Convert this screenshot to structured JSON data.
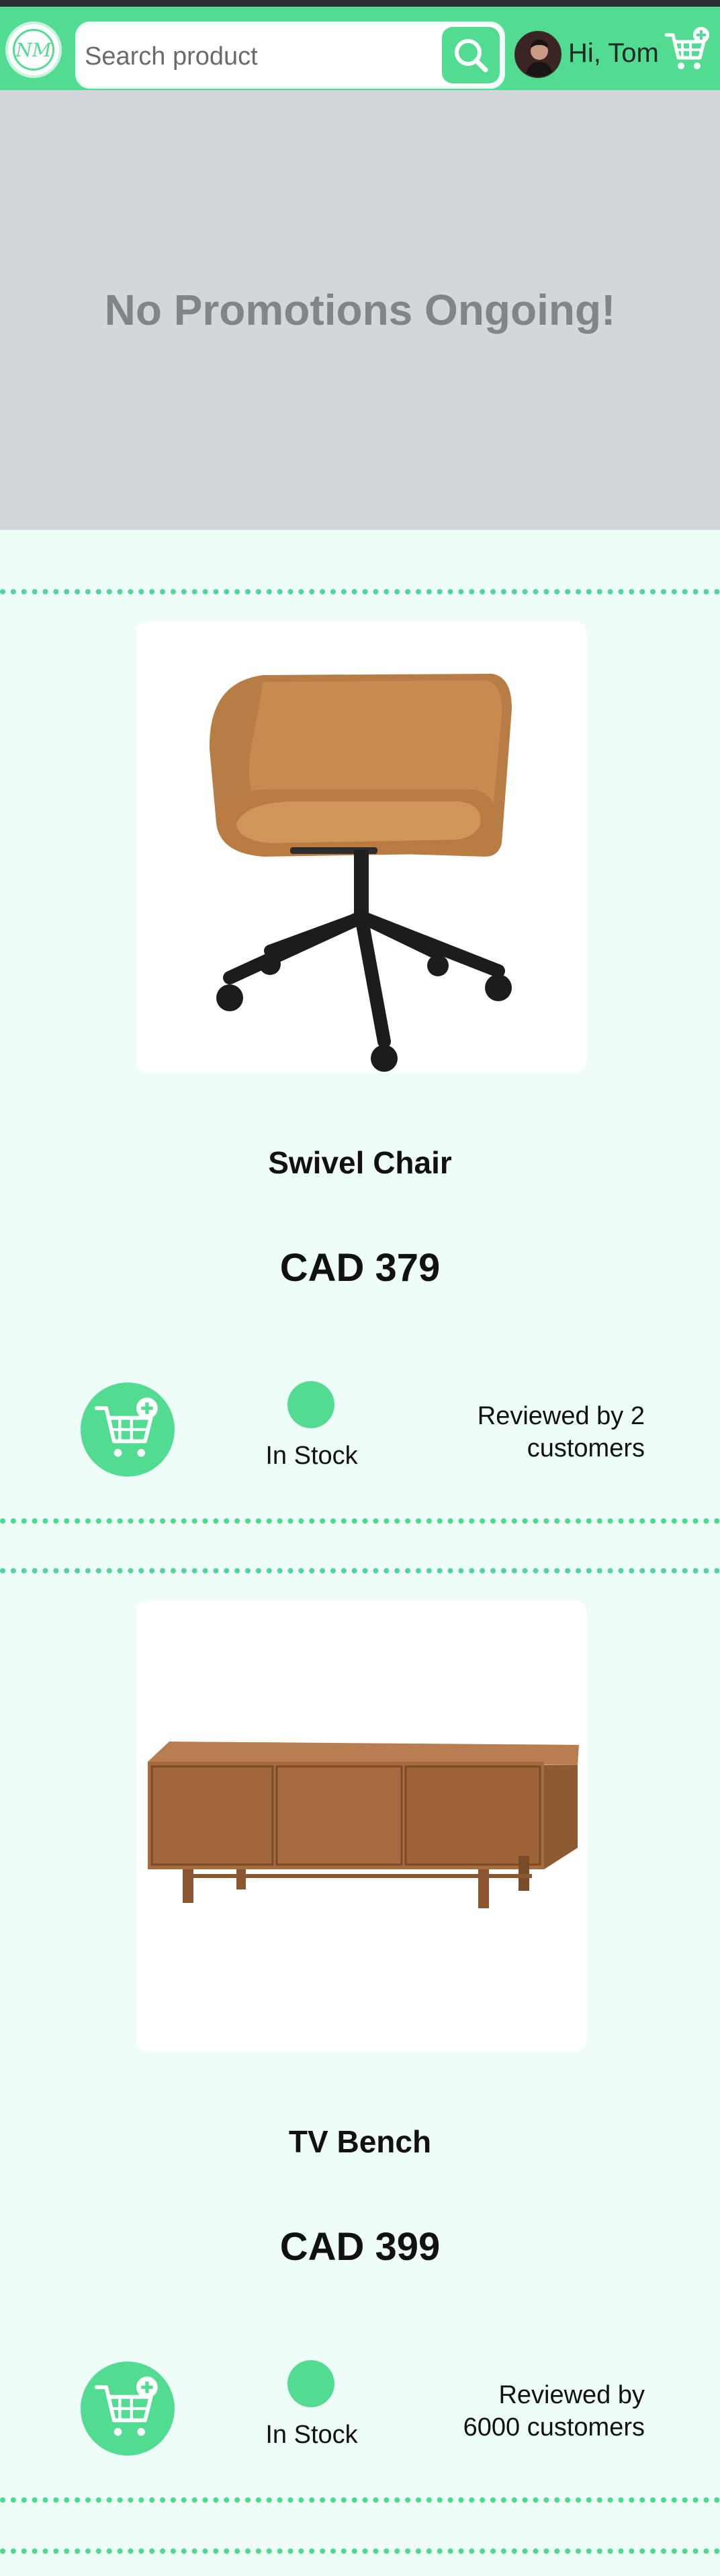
{
  "header": {
    "search_placeholder": "Search product",
    "greeting": "Hi, Tom",
    "logo_text": "NM"
  },
  "promo": {
    "text": "No Promotions Ongoing!"
  },
  "products": [
    {
      "name": "Swivel Chair",
      "price": "CAD 379",
      "stock": "In Stock",
      "reviews": "Reviewed by 2 customers"
    },
    {
      "name": "TV Bench",
      "price": "CAD 399",
      "stock": "In Stock",
      "reviews": "Reviewed by 6000 customers"
    }
  ],
  "colors": {
    "accent": "#52dc92",
    "background": "#eefdf7",
    "promo_bg": "#d3d7db",
    "promo_text": "#818589"
  },
  "icons": [
    "search-icon",
    "cart-add-icon",
    "avatar",
    "logo"
  ]
}
